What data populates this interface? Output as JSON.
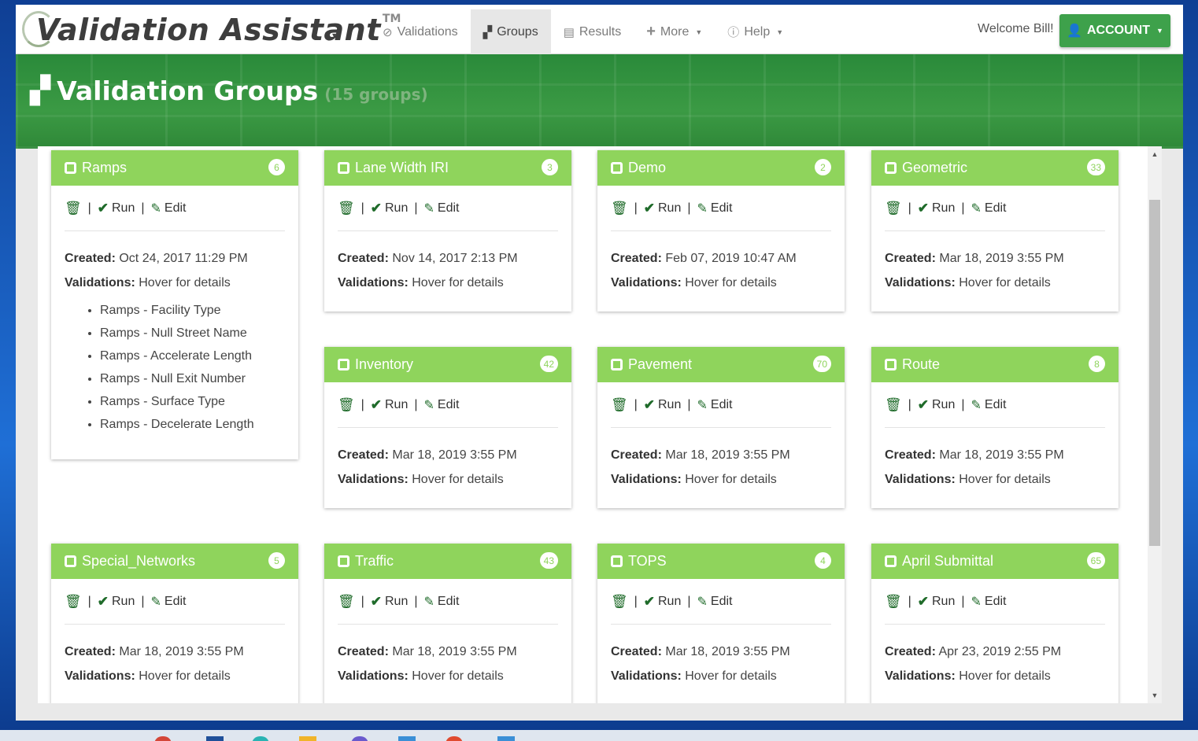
{
  "app": {
    "brand": "Validation Assistant",
    "brand_tm": "TM"
  },
  "nav": {
    "items": [
      {
        "label": "Validations",
        "icon": "check-circle-icon"
      },
      {
        "label": "Groups",
        "icon": "files-icon",
        "active": true
      },
      {
        "label": "Results",
        "icon": "list-icon"
      },
      {
        "label": "More",
        "icon": "plus-icon",
        "dropdown": true
      },
      {
        "label": "Help",
        "icon": "info-icon",
        "dropdown": true
      }
    ],
    "welcome": "Welcome Bill!",
    "account_label": "ACCOUNT"
  },
  "hero": {
    "title": "Validation Groups",
    "count": "(15 groups)"
  },
  "card_labels": {
    "run": "Run",
    "edit": "Edit",
    "created": "Created:",
    "validations": "Validations:",
    "hover": "Hover for details"
  },
  "groups": [
    {
      "name": "Ramps",
      "count": "6",
      "created": "Oct 24, 2017 11:29 PM",
      "details": [
        "Ramps - Facility Type",
        "Ramps - Null Street Name",
        "Ramps - Accelerate Length",
        "Ramps - Null Exit Number",
        "Ramps - Surface Type",
        "Ramps - Decelerate Length"
      ]
    },
    {
      "name": "Lane Width IRI",
      "count": "3",
      "created": "Nov 14, 2017 2:13 PM"
    },
    {
      "name": "Demo",
      "count": "2",
      "created": "Feb 07, 2019 10:47 AM"
    },
    {
      "name": "Geometric",
      "count": "33",
      "created": "Mar 18, 2019 3:55 PM"
    },
    {
      "name": "Inventory",
      "count": "42",
      "created": "Mar 18, 2019 3:55 PM"
    },
    {
      "name": "Pavement",
      "count": "70",
      "created": "Mar 18, 2019 3:55 PM"
    },
    {
      "name": "Route",
      "count": "8",
      "created": "Mar 18, 2019 3:55 PM"
    },
    {
      "name": "Special_Networks",
      "count": "5",
      "created": "Mar 18, 2019 3:55 PM"
    },
    {
      "name": "Traffic",
      "count": "43",
      "created": "Mar 18, 2019 3:55 PM"
    },
    {
      "name": "TOPS",
      "count": "4",
      "created": "Mar 18, 2019 3:55 PM"
    },
    {
      "name": "April Submittal",
      "count": "65",
      "created": "Apr 23, 2019 2:55 PM"
    }
  ],
  "colors": {
    "card_header": "#8fd45c",
    "account_button": "#3ea14b",
    "action_icons": "#1f6b2a"
  }
}
